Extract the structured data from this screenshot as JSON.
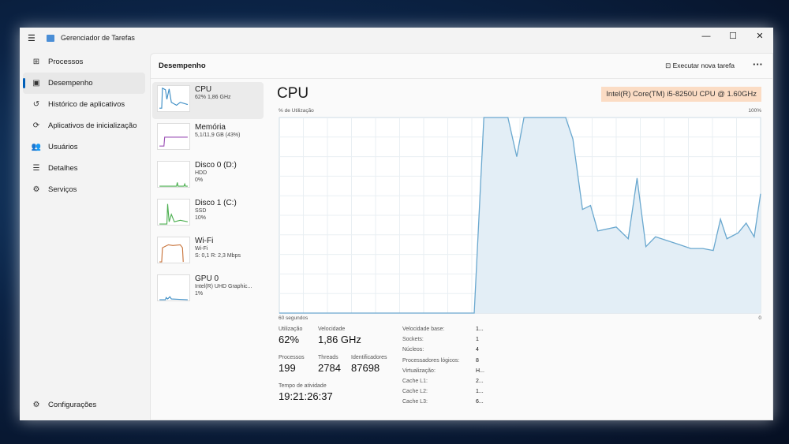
{
  "window": {
    "title": "Gerenciador de Tarefas",
    "minimize": "—",
    "maximize": "☐",
    "close": "✕"
  },
  "nav": {
    "items": [
      {
        "icon": "⊞",
        "label": "Processos"
      },
      {
        "icon": "▣",
        "label": "Desempenho"
      },
      {
        "icon": "↺",
        "label": "Histórico de aplicativos"
      },
      {
        "icon": "⟳",
        "label": "Aplicativos de inicialização"
      },
      {
        "icon": "👥",
        "label": "Usuários"
      },
      {
        "icon": "☰",
        "label": "Detalhes"
      },
      {
        "icon": "⚙",
        "label": "Serviços"
      }
    ],
    "settings": {
      "icon": "⚙",
      "label": "Configurações"
    }
  },
  "header": {
    "title": "Desempenho",
    "run_task": "Executar nova tarefa",
    "more": "···"
  },
  "devices": [
    {
      "name": "CPU",
      "sub1": "62% 1,86 GHz",
      "sub2": "",
      "color": "#3c8dc5"
    },
    {
      "name": "Memória",
      "sub1": "5,1/11,9 GB (43%)",
      "sub2": "",
      "color": "#9b4fb5"
    },
    {
      "name": "Disco 0 (D:)",
      "sub1": "HDD",
      "sub2": "0%",
      "color": "#4caf50"
    },
    {
      "name": "Disco 1 (C:)",
      "sub1": "SSD",
      "sub2": "10%",
      "color": "#4caf50"
    },
    {
      "name": "Wi-Fi",
      "sub1": "Wi-Fi",
      "sub2": "S: 0,1 R: 2,3 Mbps",
      "color": "#c8733a"
    },
    {
      "name": "GPU 0",
      "sub1": "Intel(R) UHD Graphic...",
      "sub2": "1%",
      "color": "#3c8dc5"
    }
  ],
  "detail": {
    "title": "CPU",
    "cpu_name": "Intel(R) Core(TM) i5-8250U CPU @ 1.60GHz",
    "y_label": "% de Utilização",
    "y_max": "100%",
    "x_label": "60 segundos",
    "x_min": "0"
  },
  "chart_data": {
    "type": "area",
    "xlim": [
      0,
      60
    ],
    "ylim": [
      0,
      100
    ],
    "color": "#6aa8cf",
    "fill": "#e3eef6",
    "points": [
      [
        0,
        0
      ],
      [
        24.3,
        0
      ],
      [
        25.5,
        100
      ],
      [
        28.5,
        100
      ],
      [
        29.6,
        80
      ],
      [
        30.5,
        100
      ],
      [
        35.7,
        100
      ],
      [
        36.6,
        89
      ],
      [
        37.8,
        53
      ],
      [
        38.8,
        55
      ],
      [
        39.7,
        42
      ],
      [
        42,
        44
      ],
      [
        43.5,
        38
      ],
      [
        44.6,
        69
      ],
      [
        45.7,
        34
      ],
      [
        46.9,
        39
      ],
      [
        48.4,
        37
      ],
      [
        49.9,
        35
      ],
      [
        51.3,
        33
      ],
      [
        52.8,
        33
      ],
      [
        54.1,
        32
      ],
      [
        55,
        48
      ],
      [
        55.8,
        38
      ],
      [
        57.2,
        41
      ],
      [
        58.2,
        46
      ],
      [
        59.2,
        39
      ],
      [
        60,
        61
      ]
    ]
  },
  "stats": {
    "util_label": "Utilização",
    "util": "62%",
    "speed_label": "Velocidade",
    "speed": "1,86 GHz",
    "proc_label": "Processos",
    "proc": "199",
    "threads_label": "Threads",
    "threads": "2784",
    "handles_label": "Identificadores",
    "handles": "87698",
    "uptime_label": "Tempo de atividade",
    "uptime": "19:21:26:37"
  },
  "specs": [
    {
      "k": "Velocidade base:",
      "v": "1..."
    },
    {
      "k": "Sockets:",
      "v": "1"
    },
    {
      "k": "Núcleos:",
      "v": "4"
    },
    {
      "k": "Processadores lógicos:",
      "v": "8"
    },
    {
      "k": "Virtualização:",
      "v": "H..."
    },
    {
      "k": "Cache L1:",
      "v": "2..."
    },
    {
      "k": "Cache L2:",
      "v": "1..."
    },
    {
      "k": "Cache L3:",
      "v": "6..."
    }
  ]
}
